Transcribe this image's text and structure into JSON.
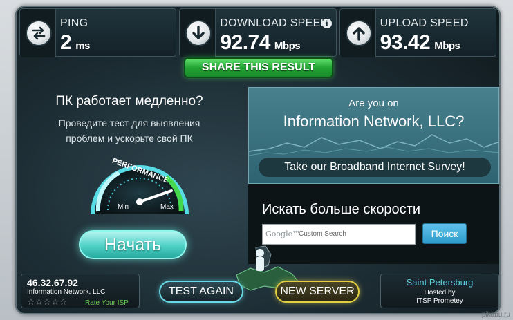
{
  "stats": {
    "ping": {
      "label": "PING",
      "value": "2",
      "unit": "ms"
    },
    "download": {
      "label": "DOWNLOAD SPEED",
      "value": "92.74",
      "unit": "Mbps",
      "info_icon": "i"
    },
    "upload": {
      "label": "UPLOAD SPEED",
      "value": "93.42",
      "unit": "Mbps"
    }
  },
  "share_button": "SHARE THIS RESULT",
  "promo": {
    "title": "ПК работает медленно?",
    "line1": "Проведите тест для выявления",
    "line2": "проблем и ускорьте свой ПК",
    "gauge_text": "PERFORMANCE",
    "gauge_min": "Min",
    "gauge_max": "Max",
    "start_button": "Начать"
  },
  "survey": {
    "question_line1": "Are you on",
    "question_line2": "Information Network, LLC?",
    "take_survey": "Take our Broadband Internet Survey!"
  },
  "search": {
    "title": "Искать больше скорости",
    "google_brand": "Google™",
    "placeholder": "Custom Search",
    "button": "Поиск"
  },
  "bottom": {
    "ip": "46.32.67.92",
    "isp": "Information Network, LLC",
    "stars": "☆☆☆☆☆",
    "rate_isp": "Rate Your ISP",
    "test_again": "TEST AGAIN",
    "new_server": "NEW SERVER",
    "server_city": "Saint Petersburg",
    "hosted_by_label": "Hosted by",
    "hosted_by": "ITSP Prometey"
  },
  "watermark": "pikabu.ru",
  "colors": {
    "panel_bg": "#1b2a31",
    "share_green": "#23a534",
    "start_teal": "#4fd1c6",
    "test_again_border": "#68d8e4",
    "new_server_border": "#e3cf42",
    "city_cyan": "#5fd0df",
    "rate_green": "#6ed04f"
  },
  "icons": {
    "ping": "exchange-arrows-icon",
    "download": "arrow-down-icon",
    "upload": "arrow-up-icon"
  }
}
